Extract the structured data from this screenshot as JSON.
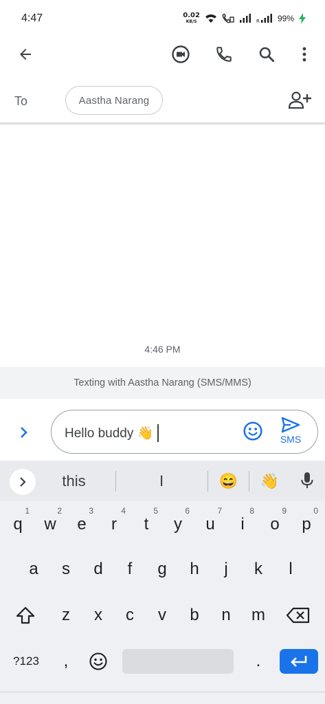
{
  "status_bar": {
    "time": "4:47",
    "net_speed_value": "0.02",
    "net_speed_unit": "KB/S",
    "battery": "99%",
    "icons": [
      "wifi-icon",
      "volte-call-icon",
      "signal-icon",
      "roaming-signal-icon",
      "charging-icon"
    ]
  },
  "app_bar": {
    "icons": [
      "back-arrow-icon",
      "video-call-icon",
      "phone-icon",
      "search-icon",
      "more-vert-icon"
    ]
  },
  "recipient": {
    "to_label": "To",
    "chip_name": "Aastha Narang",
    "add_icon": "add-person-icon"
  },
  "conversation": {
    "timestamp": "4:46 PM",
    "texting_banner": "Texting with Aastha Narang (SMS/MMS)"
  },
  "compose": {
    "message_text": "Hello buddy 👋",
    "send_label": "SMS",
    "accent_color": "#1a73e8"
  },
  "keyboard": {
    "suggestions": [
      "this",
      "I",
      "😄",
      "👋"
    ],
    "row1": [
      {
        "key": "q",
        "hint": "1"
      },
      {
        "key": "w",
        "hint": "2"
      },
      {
        "key": "e",
        "hint": "3"
      },
      {
        "key": "r",
        "hint": "4"
      },
      {
        "key": "t",
        "hint": "5"
      },
      {
        "key": "y",
        "hint": "6"
      },
      {
        "key": "u",
        "hint": "7"
      },
      {
        "key": "i",
        "hint": "8"
      },
      {
        "key": "o",
        "hint": "9"
      },
      {
        "key": "p",
        "hint": "0"
      }
    ],
    "row2": [
      "a",
      "s",
      "d",
      "f",
      "g",
      "h",
      "j",
      "k",
      "l"
    ],
    "row3": [
      "z",
      "x",
      "c",
      "v",
      "b",
      "n",
      "m"
    ],
    "symbols_label": "?123",
    "comma": ",",
    "period": "."
  }
}
